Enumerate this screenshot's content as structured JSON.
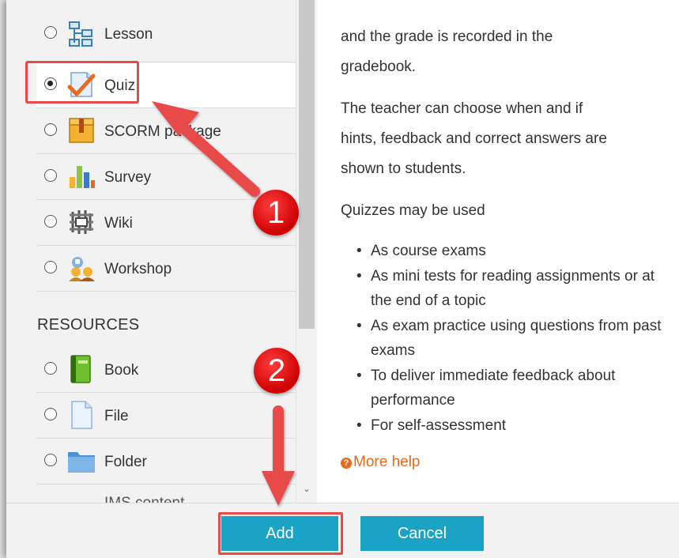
{
  "activities": [
    {
      "label": "Lesson",
      "icon": "lesson-icon",
      "selected": false
    },
    {
      "label": "Quiz",
      "icon": "quiz-icon",
      "selected": true
    },
    {
      "label": "SCORM package",
      "icon": "scorm-package-icon",
      "selected": false
    },
    {
      "label": "Survey",
      "icon": "survey-icon",
      "selected": false
    },
    {
      "label": "Wiki",
      "icon": "wiki-icon",
      "selected": false
    },
    {
      "label": "Workshop",
      "icon": "workshop-icon",
      "selected": false
    }
  ],
  "resources_heading": "RESOURCES",
  "resources": [
    {
      "label": "Book",
      "icon": "book-icon",
      "selected": false
    },
    {
      "label": "File",
      "icon": "file-icon",
      "selected": false
    },
    {
      "label": "Folder",
      "icon": "folder-icon",
      "selected": false
    },
    {
      "label": "IMS content",
      "icon": "ims-content-icon",
      "selected": false
    }
  ],
  "description": {
    "p1_line1": "and the grade is recorded in the",
    "p1_line2": "gradebook.",
    "p2_line1": "The teacher can choose when and if",
    "p2_line2": "hints, feedback and correct answers are",
    "p2_line3": "shown to students.",
    "p3": "Quizzes may be used",
    "bullets": [
      "As course exams",
      "As mini tests for reading assignments or at the end of a topic",
      "As exam practice using questions from past exams",
      "To deliver immediate feedback about performance",
      "For self-assessment"
    ],
    "more_help": "More help"
  },
  "buttons": {
    "add": "Add",
    "cancel": "Cancel"
  },
  "annotations": {
    "step1": "1",
    "step2": "2"
  },
  "colors": {
    "accent": "#1aa3c5",
    "highlight": "#e84a4a",
    "link": "#e86a1a"
  }
}
